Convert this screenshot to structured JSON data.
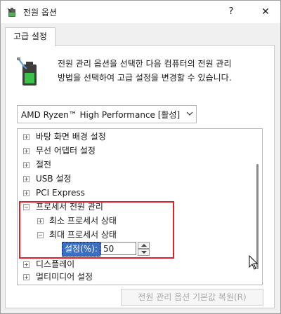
{
  "window": {
    "title": "전원 옵션",
    "help_label": "?",
    "close_label": "✕"
  },
  "tab": {
    "label": "고급 설정"
  },
  "description": {
    "line1": "전원 관리 옵션을 선택한 다음 컴퓨터의 전원 관리",
    "line2": "방법을 선택하여 고급 설정을 변경할 수 있습니다."
  },
  "plan_dropdown": {
    "selected": "AMD Ryzen™ High Performance [활성]"
  },
  "tree": {
    "items": [
      {
        "label": "바탕 화면 배경 설정",
        "expander": "+"
      },
      {
        "label": "무선 어댑터 설정",
        "expander": "+"
      },
      {
        "label": "절전",
        "expander": "+"
      },
      {
        "label": "USB 설정",
        "expander": "+"
      },
      {
        "label": "PCI Express",
        "expander": "+"
      },
      {
        "label": "프로세서 전원 관리",
        "expander": "−"
      },
      {
        "label": "최소 프로세서 상태",
        "expander": "+"
      },
      {
        "label": "최대 프로세서 상태",
        "expander": "−"
      },
      {
        "label": "디스플레이",
        "expander": "+"
      },
      {
        "label": "멀티미디어 설정",
        "expander": "+"
      }
    ],
    "setting": {
      "label": "설정(%):",
      "value": "50"
    }
  },
  "restore_button": {
    "label": "전원 관리 옵션 기본값 복원(R)"
  },
  "colors": {
    "highlight_border": "#e0202a",
    "selection_bg": "#3a6fc2"
  }
}
